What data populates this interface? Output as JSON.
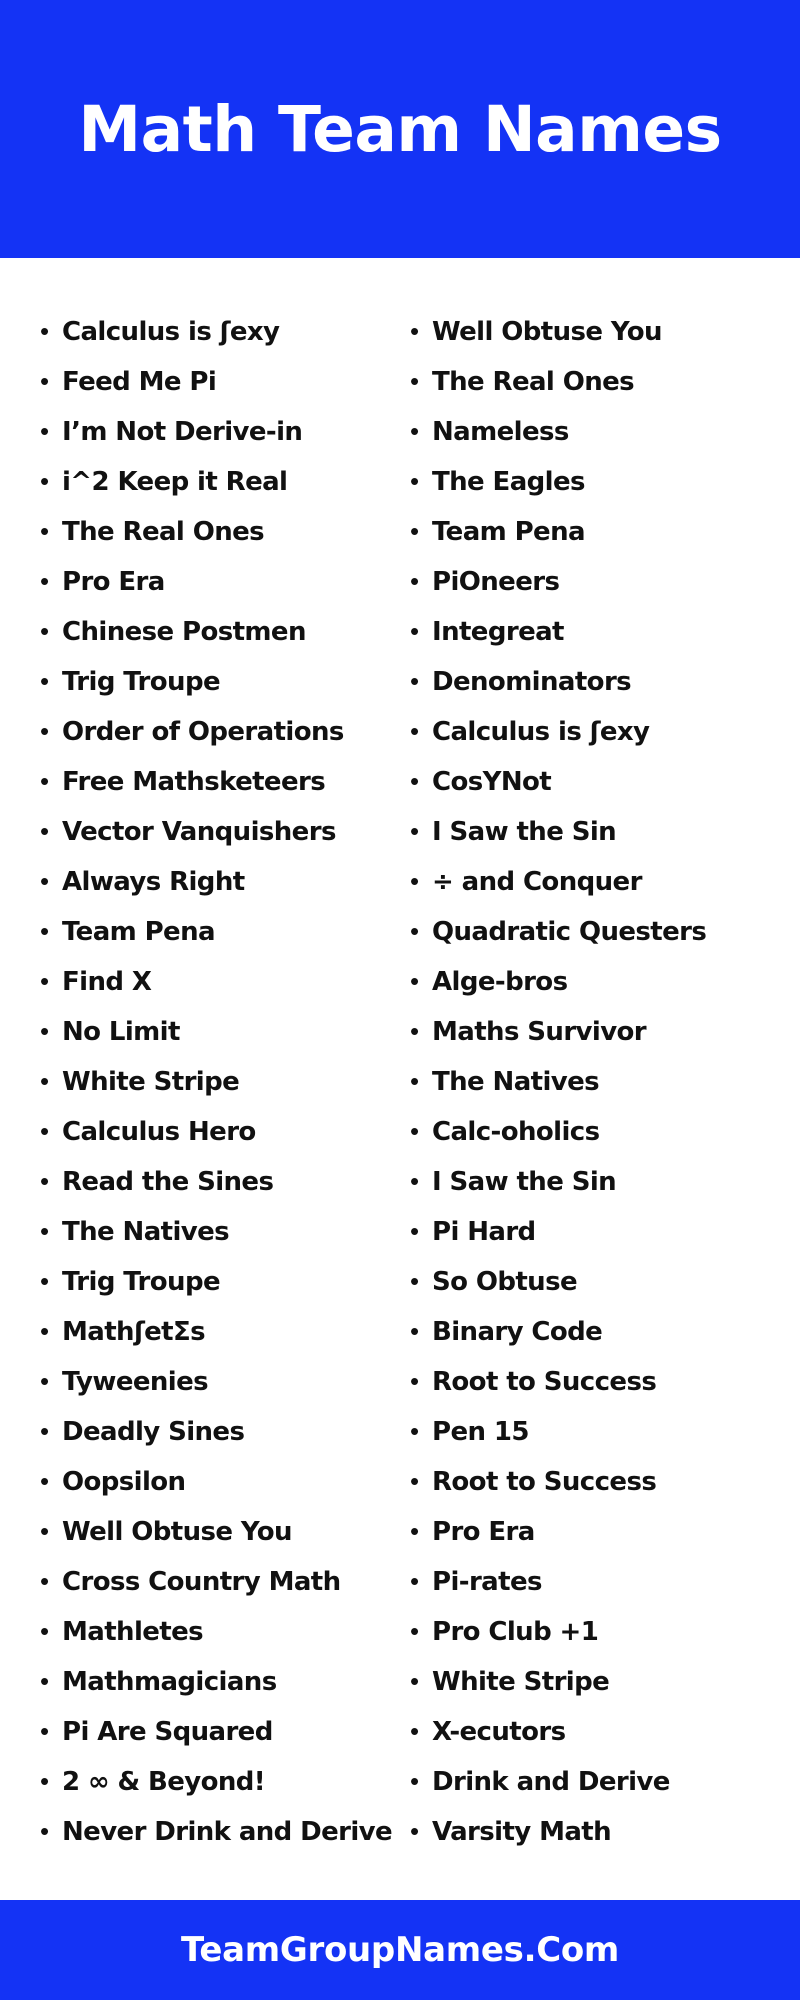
{
  "header": {
    "title": "Math Team Names",
    "background_color": "#1433f5",
    "text_color": "#ffffff"
  },
  "footer": {
    "text": "TeamGroupNames.Com",
    "background_color": "#1433f5",
    "text_color": "#ffffff"
  },
  "list": {
    "bullet_glyph": "•",
    "text_color": "#111111",
    "left_column": [
      {
        "label": "Calculus is ʃexy"
      },
      {
        "label": "Feed Me Pi"
      },
      {
        "label": "I’m Not Derive-in"
      },
      {
        "label": "i^2 Keep it Real"
      },
      {
        "label": "The Real Ones"
      },
      {
        "label": "Pro Era"
      },
      {
        "label": "Chinese Postmen"
      },
      {
        "label": "Trig Troupe"
      },
      {
        "label": "Order of Operations"
      },
      {
        "label": "Free Mathsketeers"
      },
      {
        "label": "Vector Vanquishers"
      },
      {
        "label": "Always Right"
      },
      {
        "label": "Team Pena"
      },
      {
        "label": "Find X"
      },
      {
        "label": "No Limit"
      },
      {
        "label": "White Stripe"
      },
      {
        "label": "Calculus Hero"
      },
      {
        "label": "Read the Sines"
      },
      {
        "label": "The Natives"
      },
      {
        "label": "Trig Troupe"
      },
      {
        "label": "MathʃetΣs"
      },
      {
        "label": "Tyweenies"
      },
      {
        "label": "Deadly Sines"
      },
      {
        "label": "Oopsilon"
      },
      {
        "label": "Well Obtuse You"
      },
      {
        "label": "Cross Country Math"
      },
      {
        "label": "Mathletes"
      },
      {
        "label": "Mathmagicians"
      },
      {
        "label": "Pi Are Squared"
      },
      {
        "label": "2 ∞ & Beyond!"
      },
      {
        "label": "Never Drink and Derive"
      }
    ],
    "right_column": [
      {
        "label": "Well Obtuse You"
      },
      {
        "label": "The Real Ones"
      },
      {
        "label": "Nameless"
      },
      {
        "label": "The Eagles"
      },
      {
        "label": "Team Pena"
      },
      {
        "label": "PiOneers"
      },
      {
        "label": "Integreat"
      },
      {
        "label": "Denominators"
      },
      {
        "label": "Calculus is ʃexy"
      },
      {
        "label": "CosYNot"
      },
      {
        "label": "I Saw the Sin"
      },
      {
        "label": "÷ and Conquer"
      },
      {
        "label": "Quadratic Questers"
      },
      {
        "label": "Alge-bros"
      },
      {
        "label": "Maths Survivor"
      },
      {
        "label": "The Natives"
      },
      {
        "label": "Calc-oholics"
      },
      {
        "label": "I Saw the Sin"
      },
      {
        "label": "Pi Hard"
      },
      {
        "label": "So Obtuse"
      },
      {
        "label": "Binary Code"
      },
      {
        "label": "Root to Success"
      },
      {
        "label": "Pen 15"
      },
      {
        "label": "Root to Success"
      },
      {
        "label": "Pro Era"
      },
      {
        "label": "Pi-rates"
      },
      {
        "label": "Pro Club +1"
      },
      {
        "label": "White Stripe"
      },
      {
        "label": "X-ecutors"
      },
      {
        "label": "Drink and Derive"
      },
      {
        "label": "Varsity Math"
      }
    ]
  }
}
